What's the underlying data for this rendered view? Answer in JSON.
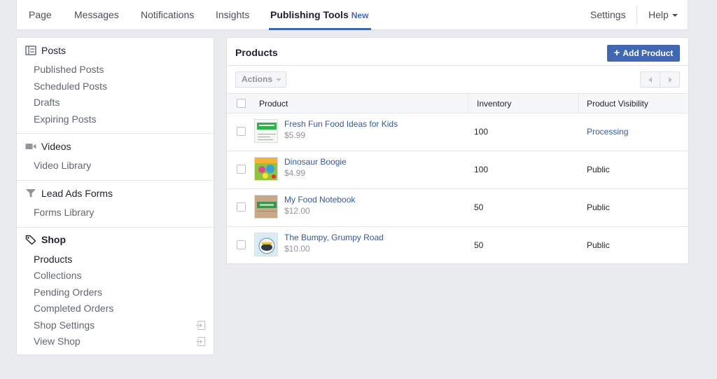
{
  "nav": {
    "page": "Page",
    "messages": "Messages",
    "notifications": "Notifications",
    "insights": "Insights",
    "publishing_tools": "Publishing Tools",
    "new_badge": "New",
    "settings": "Settings",
    "help": "Help"
  },
  "sidebar": {
    "posts": {
      "title": "Posts",
      "items": [
        "Published Posts",
        "Scheduled Posts",
        "Drafts",
        "Expiring Posts"
      ]
    },
    "videos": {
      "title": "Videos",
      "items": [
        "Video Library"
      ]
    },
    "lead_ads": {
      "title": "Lead Ads Forms",
      "items": [
        "Forms Library"
      ]
    },
    "shop": {
      "title": "Shop",
      "items": [
        "Products",
        "Collections",
        "Pending Orders",
        "Completed Orders",
        "Shop Settings",
        "View Shop"
      ]
    }
  },
  "main": {
    "title": "Products",
    "add_button": "Add Product",
    "actions_button": "Actions",
    "columns": [
      "Product",
      "Inventory",
      "Product Visibility"
    ],
    "rows": [
      {
        "name": "Fresh Fun Food Ideas for Kids",
        "price": "$5.99",
        "inventory": "100",
        "visibility": "Processing"
      },
      {
        "name": "Dinosaur Boogie",
        "price": "$4.99",
        "inventory": "100",
        "visibility": "Public"
      },
      {
        "name": "My Food Notebook",
        "price": "$12.00",
        "inventory": "50",
        "visibility": "Public"
      },
      {
        "name": "The Bumpy, Grumpy Road",
        "price": "$10.00",
        "inventory": "50",
        "visibility": "Public"
      }
    ]
  },
  "colors": {
    "accent": "#4267b2",
    "link": "#365899",
    "background": "#e9ebee"
  }
}
